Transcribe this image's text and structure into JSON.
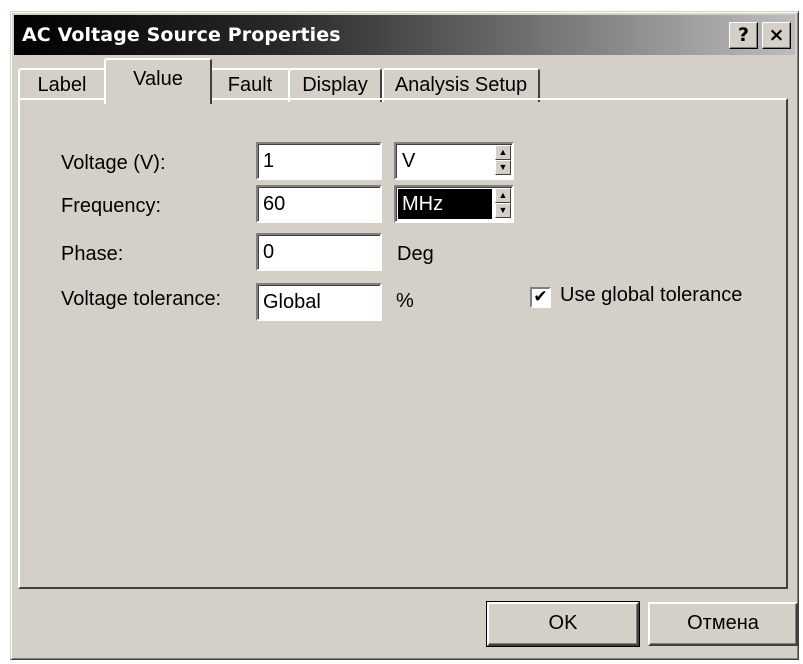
{
  "window": {
    "title": "AC Voltage Source Properties",
    "help_label": "?",
    "close_label": "×"
  },
  "tabs": [
    {
      "label": "Label",
      "active": false
    },
    {
      "label": "Value",
      "active": true
    },
    {
      "label": "Fault",
      "active": false
    },
    {
      "label": "Display",
      "active": false
    },
    {
      "label": "Analysis Setup",
      "active": false
    }
  ],
  "fields": {
    "voltage": {
      "label": "Voltage (V):",
      "value": "1",
      "unit": "V"
    },
    "frequency": {
      "label": "Frequency:",
      "value": "60",
      "unit": "MHz"
    },
    "phase": {
      "label": "Phase:",
      "value": "0",
      "unit": "Deg"
    },
    "tolerance": {
      "label": "Voltage tolerance:",
      "value": "Global",
      "unit": "%"
    }
  },
  "checkbox": {
    "label": "Use global tolerance",
    "checked": true,
    "mark": "✔"
  },
  "buttons": {
    "ok": "OK",
    "cancel": "Отмена"
  },
  "colors": {
    "face": "#d4d0c8",
    "title_start": "#000000",
    "title_end": "#bdbdbd",
    "selection": "#000000"
  }
}
